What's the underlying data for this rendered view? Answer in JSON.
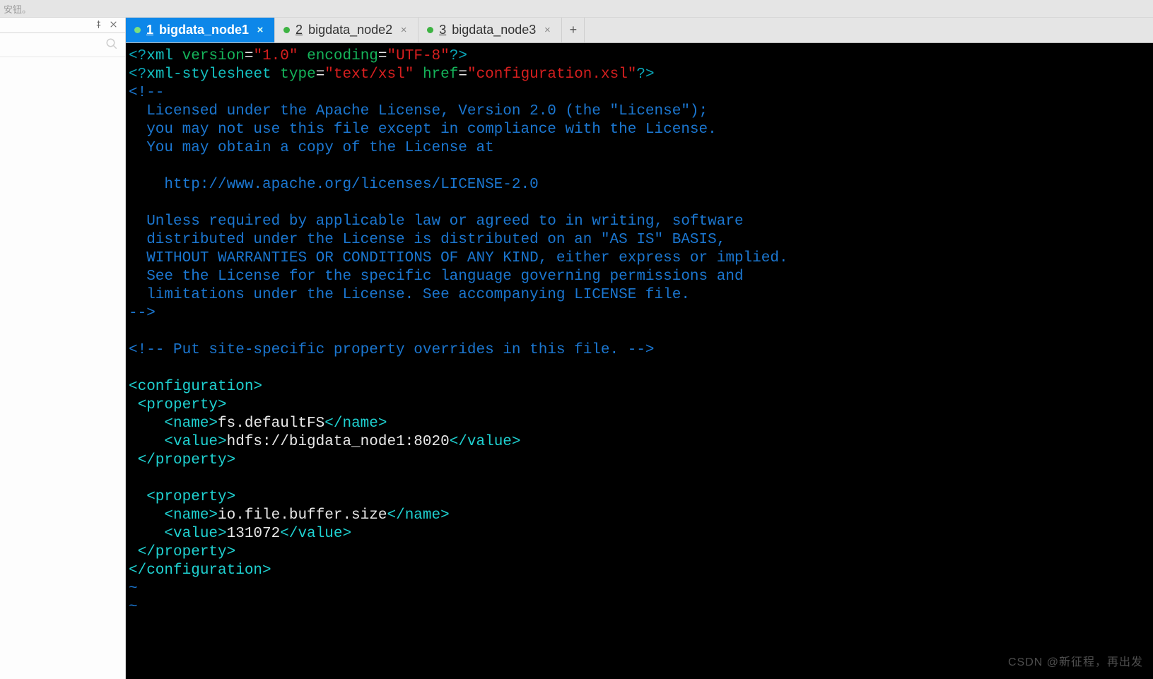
{
  "topstrip": {
    "text": "安钮。"
  },
  "tabs": [
    {
      "num": "1",
      "label": "bigdata_node1",
      "active": true
    },
    {
      "num": "2",
      "label": "bigdata_node2",
      "active": false
    },
    {
      "num": "3",
      "label": "bigdata_node3",
      "active": false
    }
  ],
  "editor": {
    "xml_decl": {
      "open": "<?",
      "keyword": "xml",
      "version_key": "version",
      "version_val": "\"1.0\"",
      "encoding_key": "encoding",
      "encoding_val": "\"UTF-8\"",
      "close": "?>"
    },
    "stylesheet": {
      "open": "<?",
      "keyword": "xml-stylesheet",
      "type_key": "type",
      "type_val": "\"text/xsl\"",
      "href_key": "href",
      "href_val": "\"configuration.xsl\"",
      "close": "?>"
    },
    "license_open": "<!--",
    "license_lines": [
      "  Licensed under the Apache License, Version 2.0 (the \"License\");",
      "  you may not use this file except in compliance with the License.",
      "  You may obtain a copy of the License at",
      "",
      "    http://www.apache.org/licenses/LICENSE-2.0",
      "",
      "  Unless required by applicable law or agreed to in writing, software",
      "  distributed under the License is distributed on an \"AS IS\" BASIS,",
      "  WITHOUT WARRANTIES OR CONDITIONS OF ANY KIND, either express or implied.",
      "  See the License for the specific language governing permissions and",
      "  limitations under the License. See accompanying LICENSE file."
    ],
    "license_close": "-->",
    "site_comment": "<!-- Put site-specific property overrides in this file. -->",
    "cfg_open": "<configuration>",
    "cfg_close": "</configuration>",
    "prop_open": " <property>",
    "prop_close": " </property>",
    "prop1": {
      "name_open": "    <name>",
      "name_val": "fs.defaultFS",
      "name_close": "</name>",
      "value_open": "    <value>",
      "value_val": "hdfs://bigdata_node1:8020",
      "value_close": "</value>"
    },
    "prop2_open": "  <property>",
    "prop2": {
      "name_open": "    <name>",
      "name_val": "io.file.buffer.size",
      "name_close": "</name>",
      "value_open": "    <value>",
      "value_val": "131072",
      "value_close": "</value>"
    },
    "tilde": "~"
  },
  "watermark": "CSDN @新征程，再出发"
}
